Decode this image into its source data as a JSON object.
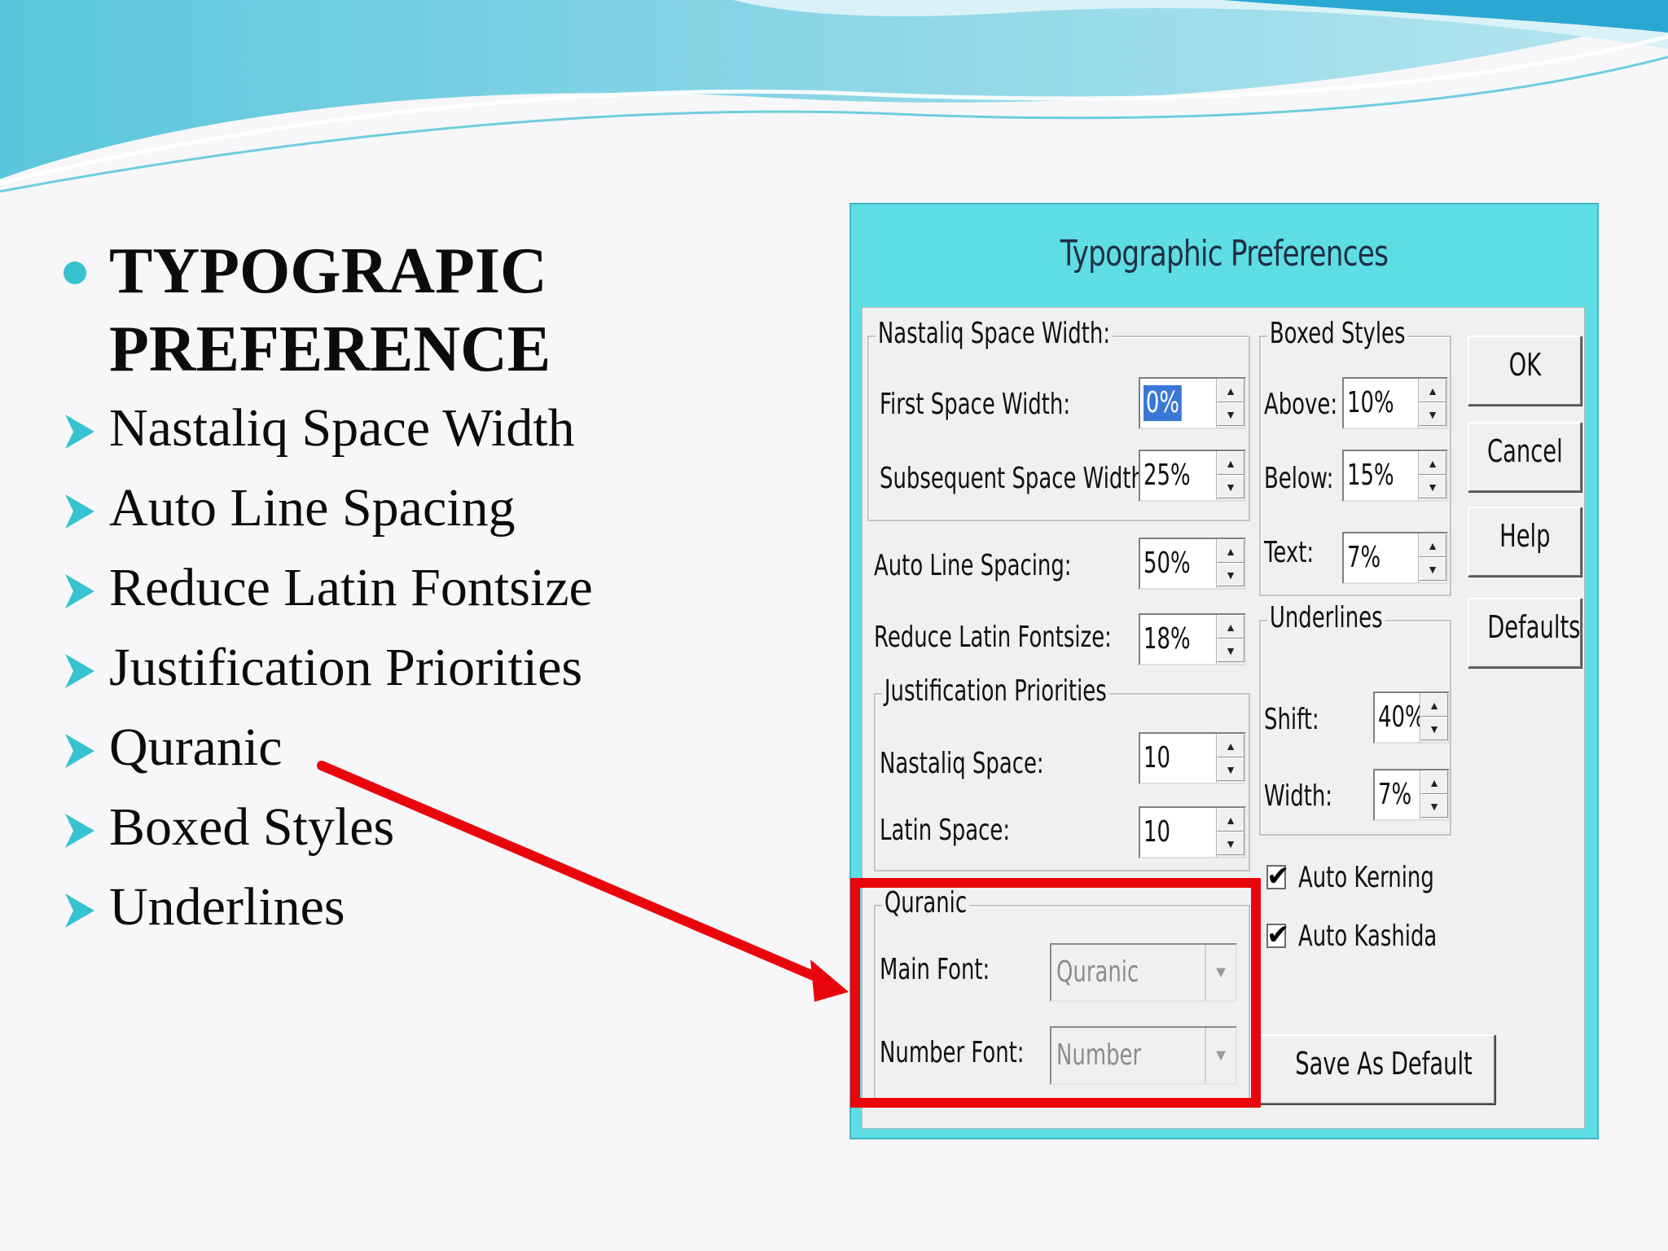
{
  "slide": {
    "heading_lines": [
      "TYPOGRAPIC",
      "PREFERENCE"
    ],
    "bullets": [
      "Nastaliq Space Width",
      "Auto Line Spacing",
      "Reduce Latin Fontsize",
      "Justification Priorities",
      "Quranic",
      "Boxed Styles",
      "Underlines"
    ]
  },
  "colors": {
    "accent": "#37c3cf",
    "dialog_frame": "#5fdde5",
    "highlight": "#e8060c"
  },
  "dialog": {
    "title": "Typographic Preferences",
    "nastaliq": {
      "title": "Nastaliq Space Width:",
      "first_label": "First Space Width:",
      "first_value": "0%",
      "subsequent_label": "Subsequent Space Width:",
      "subsequent_value": "25%"
    },
    "auto_line_label": "Auto Line Spacing:",
    "auto_line_value": "50%",
    "reduce_latin_label": "Reduce Latin Fontsize:",
    "reduce_latin_value": "18%",
    "justification": {
      "title": "Justification Priorities",
      "nastaliq_label": "Nastaliq Space:",
      "nastaliq_value": "10",
      "latin_label": "Latin Space:",
      "latin_value": "10"
    },
    "quranic": {
      "title": "Quranic",
      "main_label": "Main Font:",
      "main_value": "Quranic",
      "number_label": "Number Font:",
      "number_value": "Number"
    },
    "boxed": {
      "title": "Boxed Styles",
      "above_label": "Above:",
      "above_value": "10%",
      "below_label": "Below:",
      "below_value": "15%",
      "text_label": "Text:",
      "text_value": "7%"
    },
    "underlines": {
      "title": "Underlines",
      "shift_label": "Shift:",
      "shift_value": "40%",
      "width_label": "Width:",
      "width_value": "7%"
    },
    "auto_kerning_label": "Auto Kerning",
    "auto_kashida_label": "Auto Kashida",
    "buttons": {
      "ok": "OK",
      "cancel": "Cancel",
      "help": "Help",
      "defaults": "Defaults",
      "save_default": "Save As Default"
    }
  }
}
